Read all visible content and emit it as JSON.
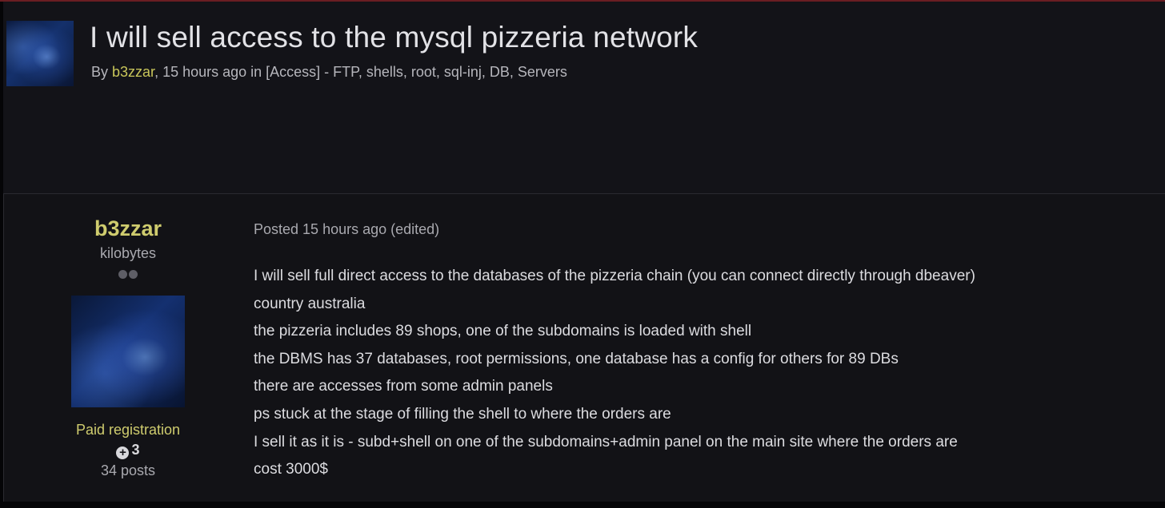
{
  "topic": {
    "title": "I will sell access to the mysql pizzeria network",
    "meta_prefix": "By ",
    "author": "b3zzar",
    "meta_suffix": ", 15 hours ago in [Access] - FTP, shells, root, sql-inj, DB, Servers"
  },
  "post": {
    "author": {
      "name": "b3zzar",
      "rank": "kilobytes",
      "group": "Paid registration",
      "reputation": "3",
      "post_count": "34 posts"
    },
    "posted": "Posted 15 hours ago (edited)",
    "lines": [
      "I will sell full direct access to the databases of the pizzeria chain (you can connect directly through dbeaver)",
      "country australia",
      "the pizzeria includes 89 shops, one of the subdomains is loaded with shell",
      "the DBMS has 37 databases, root permissions, one database has a config for others for 89 DBs",
      "there are accesses from some admin panels",
      "ps stuck at the stage of filling the shell to where the orders are",
      "I sell it as it is - subd+shell on one of the subdomains+admin panel on the main site where the orders are",
      "cost 3000$"
    ]
  },
  "colors": {
    "background": "#131318",
    "author_accent": "#cfcc6e",
    "text": "#dcdce0",
    "muted": "#a9a9af"
  }
}
